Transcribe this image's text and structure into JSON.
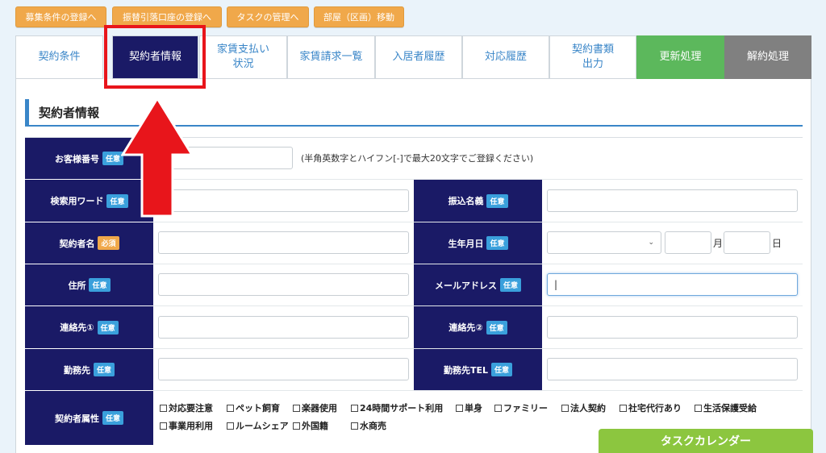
{
  "topbar": {
    "buttons": [
      "募集条件の登録へ",
      "振替引落口座の登録へ",
      "タスクの管理へ",
      "部屋（区画）移動"
    ]
  },
  "tabs": [
    {
      "label": "契約条件",
      "state": "normal"
    },
    {
      "label": "契約者情報",
      "state": "active"
    },
    {
      "label": "家賃支払い\n状況",
      "state": "normal"
    },
    {
      "label": "家賃請求一覧",
      "state": "normal"
    },
    {
      "label": "入居者履歴",
      "state": "normal"
    },
    {
      "label": "対応履歴",
      "state": "normal"
    },
    {
      "label": "契約書類\n出力",
      "state": "normal"
    },
    {
      "label": "更新処理",
      "state": "renew"
    },
    {
      "label": "解約処理",
      "state": "cancel"
    }
  ],
  "section": {
    "title": "契約者情報"
  },
  "badges": {
    "optional": "任意",
    "required": "必須"
  },
  "form": {
    "customer_no": {
      "label": "お客様番号",
      "note": "(半角英数字とハイフン[-]で最大20文字でご登録ください)"
    },
    "search_word": {
      "label": "検索用ワード"
    },
    "transfer_name": {
      "label": "振込名義"
    },
    "contractor_name": {
      "label": "契約者名"
    },
    "birthdate": {
      "label": "生年月日",
      "month_unit": "月",
      "day_unit": "日"
    },
    "address": {
      "label": "住所"
    },
    "email": {
      "label": "メールアドレス",
      "value": "|"
    },
    "contact1": {
      "label": "連絡先①"
    },
    "contact2": {
      "label": "連絡先②"
    },
    "workplace": {
      "label": "勤務先"
    },
    "workplace_tel": {
      "label": "勤務先TEL"
    },
    "attributes": {
      "label": "契約者属性",
      "options": [
        "対応要注意",
        "ペット飼育",
        "楽器使用",
        "24時間サポート利用",
        "単身",
        "ファミリー",
        "法人契約",
        "社宅代行あり",
        "生活保護受給",
        "事業用利用",
        "ルームシェア",
        "外国籍",
        "水商売"
      ]
    }
  },
  "task_calendar": "タスクカレンダー",
  "colors": {
    "accent": "#1a1a66",
    "highlight": "#e8151b",
    "orange": "#f0a84a",
    "green": "#5cb85c"
  }
}
